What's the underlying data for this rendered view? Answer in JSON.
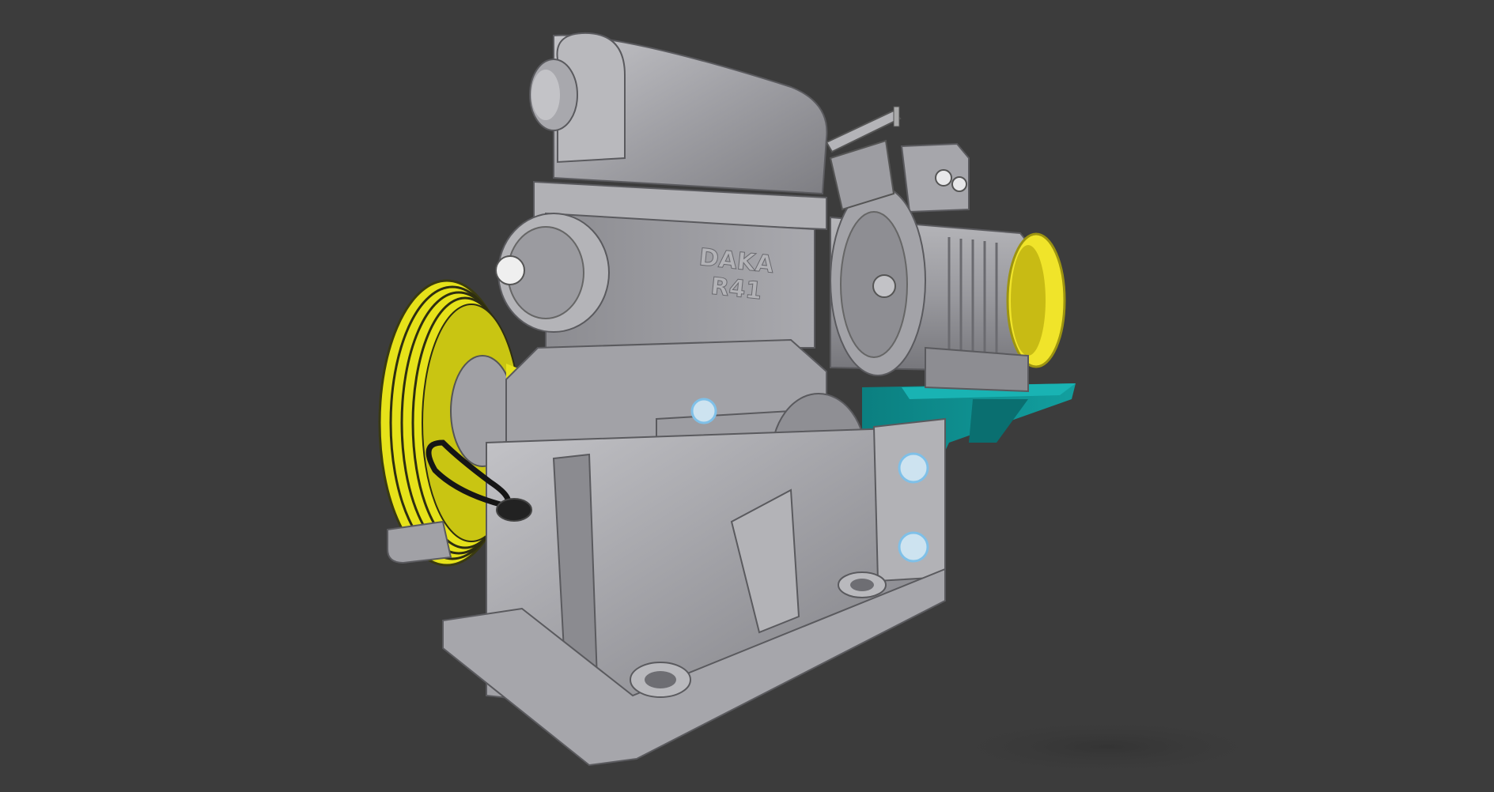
{
  "scene": {
    "background": "#3c3c3c",
    "casting_label_line1": "DAKA",
    "casting_label_line2": "R41"
  },
  "colors": {
    "housing": "#9c9ca1",
    "housing_light": "#c9c9cd",
    "housing_dark": "#6e6e73",
    "sheave": "#e6e21a",
    "motor_cap": "#f0e42a",
    "base_frame": "#0e8f8f",
    "bolt_highlight": "#7fc0e8",
    "oil_gauge": "#151515"
  },
  "icons": {
    "model": "gear-motor-3d-model"
  }
}
